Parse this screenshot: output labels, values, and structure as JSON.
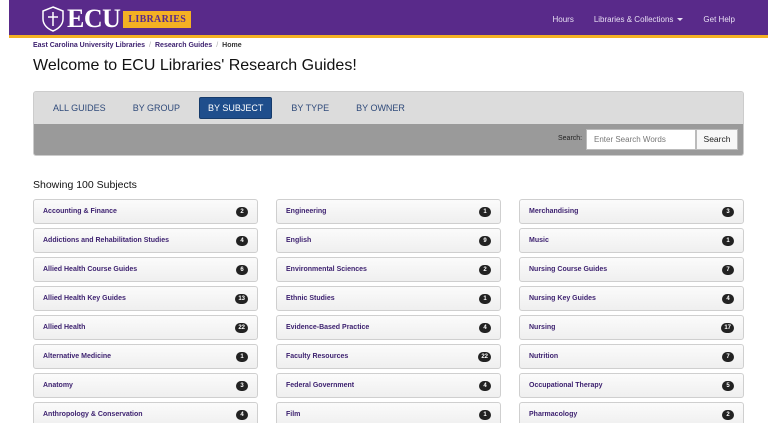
{
  "header": {
    "logo_text": "ECU",
    "logo_sub": "LIBRARIES",
    "nav": [
      {
        "label": "Hours"
      },
      {
        "label": "Libraries & Collections"
      },
      {
        "label": "Get Help"
      }
    ],
    "colors": {
      "bar": "#592a8a",
      "accent": "#f4b123"
    }
  },
  "breadcrumb": {
    "items": [
      "East Carolina University Libraries",
      "Research Guides"
    ],
    "current": "Home"
  },
  "page_title": "Welcome to ECU Libraries' Research Guides!",
  "tabs": [
    {
      "label": "ALL GUIDES",
      "active": false
    },
    {
      "label": "BY GROUP",
      "active": false
    },
    {
      "label": "BY SUBJECT",
      "active": true
    },
    {
      "label": "BY TYPE",
      "active": false
    },
    {
      "label": "BY OWNER",
      "active": false
    }
  ],
  "search": {
    "label": "Search:",
    "placeholder": "Enter Search Words",
    "button": "Search"
  },
  "showing": "Showing 100 Subjects",
  "columns": [
    [
      {
        "label": "Accounting & Finance",
        "count": "2"
      },
      {
        "label": "Addictions and Rehabilitation Studies",
        "count": "4"
      },
      {
        "label": "Allied Health Course Guides",
        "count": "6"
      },
      {
        "label": "Allied Health Key Guides",
        "count": "13"
      },
      {
        "label": "Allied Health",
        "count": "22"
      },
      {
        "label": "Alternative Medicine",
        "count": "1"
      },
      {
        "label": "Anatomy",
        "count": "3"
      },
      {
        "label": "Anthropology & Conservation",
        "count": "4"
      }
    ],
    [
      {
        "label": "Engineering",
        "count": "1"
      },
      {
        "label": "English",
        "count": "9"
      },
      {
        "label": "Environmental Sciences",
        "count": "2"
      },
      {
        "label": "Ethnic Studies",
        "count": "1"
      },
      {
        "label": "Evidence-Based Practice",
        "count": "4"
      },
      {
        "label": "Faculty Resources",
        "count": "22"
      },
      {
        "label": "Federal Government",
        "count": "4"
      },
      {
        "label": "Film",
        "count": "1"
      }
    ],
    [
      {
        "label": "Merchandising",
        "count": "3"
      },
      {
        "label": "Music",
        "count": "1"
      },
      {
        "label": "Nursing Course Guides",
        "count": "7"
      },
      {
        "label": "Nursing Key Guides",
        "count": "4"
      },
      {
        "label": "Nursing",
        "count": "17"
      },
      {
        "label": "Nutrition",
        "count": "7"
      },
      {
        "label": "Occupational Therapy",
        "count": "5"
      },
      {
        "label": "Pharmacology",
        "count": "2"
      }
    ]
  ]
}
